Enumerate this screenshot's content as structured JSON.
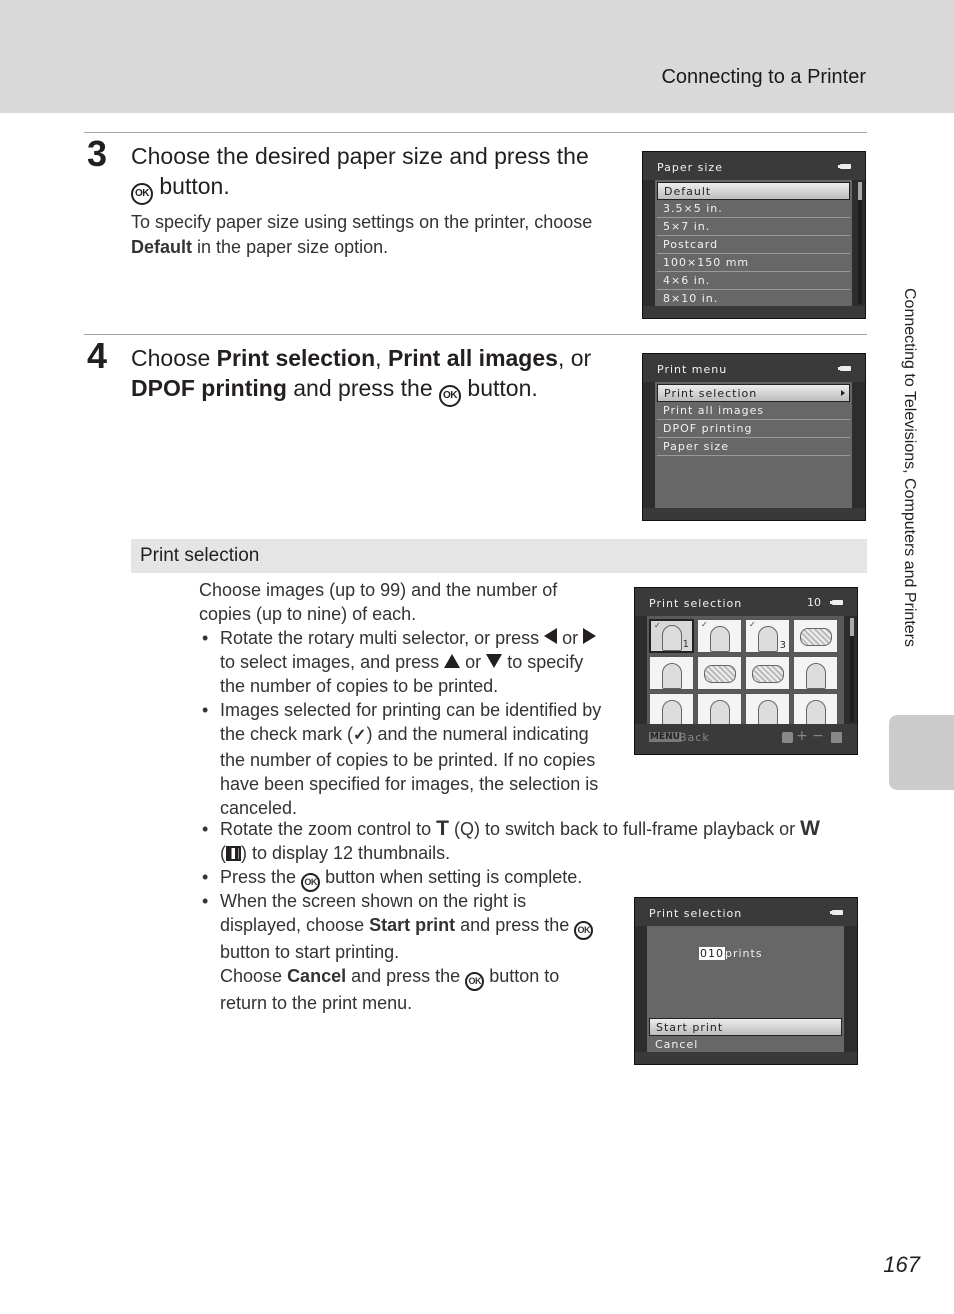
{
  "header": {
    "title": "Connecting to a Printer"
  },
  "sidebar": {
    "chapter_title": "Connecting to Televisions, Computers and Printers"
  },
  "steps": [
    {
      "number": "3",
      "title_parts": [
        "Choose the desired paper size and press the",
        "button."
      ],
      "body_parts": [
        "To specify paper size using settings on the printer, choose",
        "Default",
        "in the paper size option."
      ]
    },
    {
      "number": "4",
      "title_parts": [
        "Choose",
        "Print selection",
        ",",
        "Print all images",
        ", or",
        "DPOF printing",
        "and press the",
        "button."
      ]
    }
  ],
  "icons": {
    "ok": "OK",
    "check": "✓",
    "zoom_glyph": "Q"
  },
  "screens": {
    "paper_size": {
      "title": "Paper size",
      "items": [
        "Default",
        "3.5×5 in.",
        "5×7 in.",
        "Postcard",
        "100×150 mm",
        "4×6 in.",
        "8×10 in."
      ],
      "selected_index": 0
    },
    "print_menu": {
      "title": "Print menu",
      "items": [
        "Print selection",
        "Print all images",
        "DPOF printing",
        "Paper size"
      ],
      "selected_index": 0
    },
    "print_selection_grid": {
      "title": "Print selection",
      "count": "10",
      "footer_menu": "MENU",
      "footer_back": "Back",
      "footer_controls": "+ −",
      "thumbnails": [
        {
          "type": "portrait",
          "checked": true,
          "copies": "1",
          "selected": true
        },
        {
          "type": "mother-child",
          "checked": true,
          "copies": "",
          "selected": false
        },
        {
          "type": "family",
          "checked": true,
          "copies": "3",
          "selected": false
        },
        {
          "type": "flowers",
          "checked": false,
          "copies": "",
          "selected": false
        },
        {
          "type": "portrait",
          "checked": false,
          "copies": "",
          "selected": false
        },
        {
          "type": "flowers",
          "checked": false,
          "copies": "",
          "selected": false
        },
        {
          "type": "flowers",
          "checked": false,
          "copies": "",
          "selected": false
        },
        {
          "type": "mother-child",
          "checked": false,
          "copies": "",
          "selected": false
        },
        {
          "type": "mother-child",
          "checked": false,
          "copies": "",
          "selected": false
        },
        {
          "type": "family",
          "checked": false,
          "copies": "",
          "selected": false
        },
        {
          "type": "portrait",
          "checked": false,
          "copies": "",
          "selected": false
        },
        {
          "type": "portrait",
          "checked": false,
          "copies": "",
          "selected": false
        }
      ]
    },
    "print_confirm": {
      "title": "Print selection",
      "count_value": "010",
      "count_label": "prints",
      "items": [
        "Start print",
        "Cancel"
      ],
      "selected_index": 0
    }
  },
  "print_selection_section": {
    "heading": "Print selection",
    "intro": "Choose images (up to 99) and the number of copies (up to nine) of each.",
    "bullet1": [
      "Rotate the rotary multi selector, or press",
      "or",
      "to select images, and press",
      "or",
      "to specify the number of copies to be printed."
    ],
    "bullet2": [
      "Images selected for printing can be identified by the check mark (",
      ") and the numeral indicating the number of copies to be printed. If no copies have been specified for images, the selection is canceled."
    ],
    "bullet3": [
      "Rotate the zoom control to",
      "T",
      "(",
      ") to switch back to full-frame playback or",
      "W",
      "(",
      ") to display 12 thumbnails."
    ],
    "bullet4": [
      "Press the",
      "button when setting is complete."
    ],
    "bullet5": [
      "When the screen shown on the right is displayed, choose",
      "Start print",
      "and press the",
      "button to start printing.",
      "Choose",
      "Cancel",
      "and press the",
      "button to return to the print menu."
    ]
  },
  "page_number": "167"
}
